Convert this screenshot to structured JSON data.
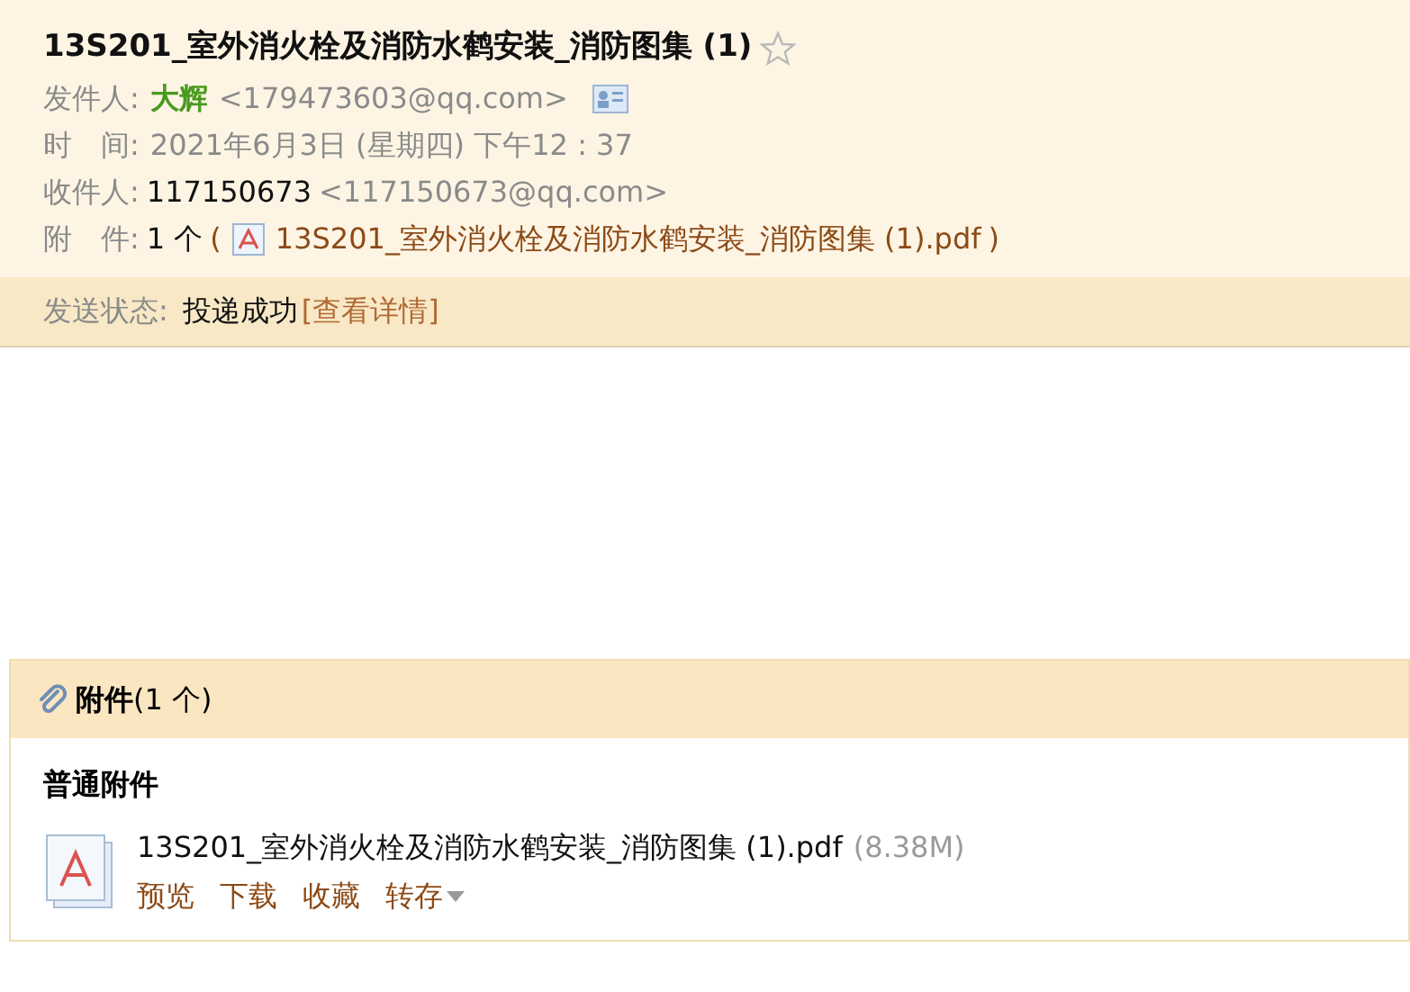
{
  "subject": "13S201_室外消火栓及消防水鹤安装_消防图集 (1)",
  "starred": false,
  "fields": [
    {
      "kind": "sender",
      "label": "发件人:",
      "name": "大辉",
      "address": "<179473603@qq.com>"
    },
    {
      "kind": "time",
      "label": "时　间:",
      "value": "2021年6月3日 (星期四) 下午12 : 37"
    },
    {
      "kind": "recipient",
      "label": "收件人:",
      "name": "117150673",
      "address": "<117150673@qq.com>"
    },
    {
      "kind": "attachment",
      "label": "附　件:",
      "count": "1 个",
      "open": "(",
      "file": "13S201_室外消火栓及消防水鹤安装_消防图集 (1).pdf",
      "close": ")"
    }
  ],
  "status": {
    "label": "发送状态:",
    "value": "投递成功",
    "link": "[查看详情]"
  },
  "attachments_panel": {
    "title": "附件",
    "count": "(1 个)",
    "section": "普通附件",
    "files": [
      {
        "name": "13S201_室外消火栓及消防水鹤安装_消防图集 (1).pdf",
        "size": "(8.38M)",
        "actions": [
          "预览",
          "下载",
          "收藏",
          "转存"
        ]
      }
    ]
  }
}
